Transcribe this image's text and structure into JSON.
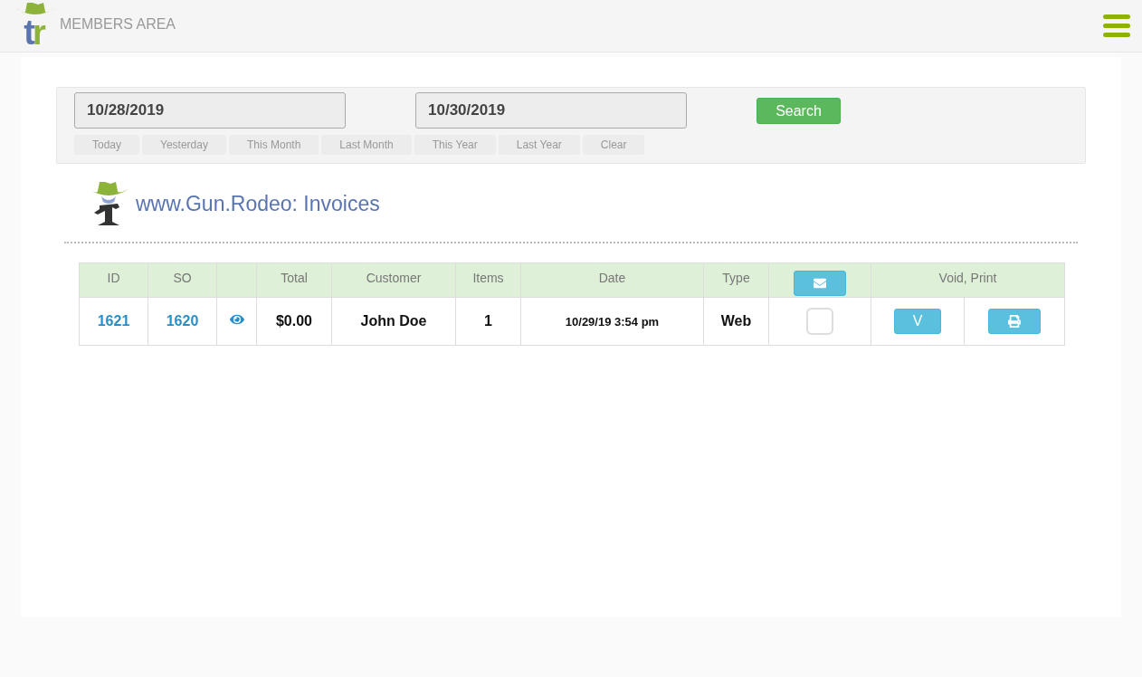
{
  "header": {
    "logo_text": "tr",
    "title": "MEMBERS AREA"
  },
  "filter": {
    "from": "10/28/2019",
    "to": "10/30/2019",
    "search": "Search",
    "presets": [
      "Today",
      "Yesterday",
      "This Month",
      "Last Month",
      "This Year",
      "Last Year",
      "Clear"
    ]
  },
  "page_title": "www.Gun.Rodeo: Invoices",
  "table": {
    "columns": [
      "ID",
      "SO",
      "",
      "Total",
      "Customer",
      "Items",
      "Date",
      "Type"
    ],
    "actions_header": "Void, Print",
    "rows": [
      {
        "id": "1621",
        "so": "1620",
        "total": "$0.00",
        "customer": "John Doe",
        "items": "1",
        "date": "10/29/19 3:54 pm",
        "type": "Web",
        "checked": false,
        "void": "V"
      }
    ]
  }
}
